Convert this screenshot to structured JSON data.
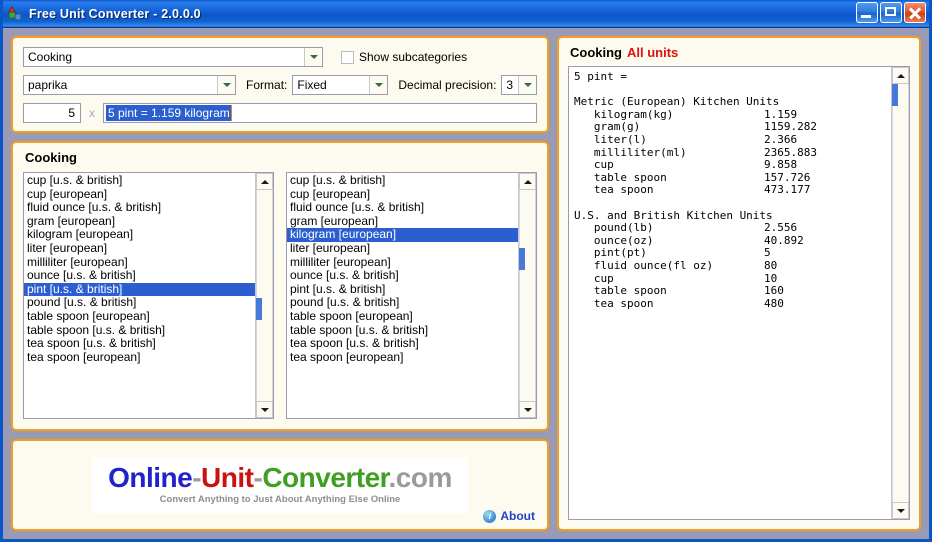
{
  "window": {
    "title": "Free Unit Converter - 2.0.0.0",
    "app_icon": "blocks-icon",
    "minimize_label": "Minimize",
    "maximize_label": "Maximize",
    "close_label": "Close"
  },
  "controls": {
    "category": {
      "value": "Cooking",
      "icon": "chevron-down-icon"
    },
    "show_subcategories": {
      "label": "Show subcategories",
      "checked": false
    },
    "subcategory": {
      "value": "paprika",
      "icon": "chevron-down-icon"
    },
    "format": {
      "label": "Format:",
      "value": "Fixed",
      "icon": "chevron-down-icon"
    },
    "precision": {
      "label": "Decimal precision:",
      "value": "3",
      "icon": "chevron-down-icon"
    },
    "amount": {
      "value": "5"
    },
    "separator": "x",
    "result": {
      "value": "5 pint = 1.159 kilogram"
    }
  },
  "lists": {
    "title": "Cooking",
    "from": {
      "selected": "pint [u.s. & british]",
      "items": [
        "cup [u.s. & british]",
        "cup [european]",
        "fluid ounce [u.s. & british]",
        "gram [european]",
        "kilogram [european]",
        "liter [european]",
        "milliliter [european]",
        "ounce [u.s. & british]",
        "pint [u.s. & british]",
        "pound [u.s. & british]",
        "table spoon [european]",
        "table spoon [u.s. & british]",
        "tea spoon [u.s. & british]",
        "tea spoon [european]"
      ]
    },
    "to": {
      "selected": "kilogram [european]",
      "items": [
        "cup [u.s. & british]",
        "cup [european]",
        "fluid ounce [u.s. & british]",
        "gram [european]",
        "kilogram [european]",
        "liter [european]",
        "milliliter [european]",
        "ounce [u.s. & british]",
        "pint [u.s. & british]",
        "pound [u.s. & british]",
        "table spoon [european]",
        "table spoon [u.s. & british]",
        "tea spoon [u.s. & british]",
        "tea spoon [european]"
      ]
    }
  },
  "branding": {
    "logo": {
      "part1": "Online",
      "dash1": "-",
      "part2": "Unit",
      "dash2": "-",
      "part3": "Converter",
      "part4": ".com",
      "color1": "#2222cc",
      "color2": "#cc1111",
      "color3": "#3f9f22",
      "color_gray": "#9a9a9a"
    },
    "tagline": "Convert Anything to Just About Anything Else Online",
    "about": {
      "label": "About",
      "icon": "info-icon"
    }
  },
  "results": {
    "category": "Cooking",
    "scope": "All units",
    "header": "5 pint =",
    "groups": [
      {
        "name": "Metric (European) Kitchen Units",
        "rows": [
          {
            "unit": "kilogram(kg)",
            "value": "1.159"
          },
          {
            "unit": "gram(g)",
            "value": "1159.282"
          },
          {
            "unit": "liter(l)",
            "value": "2.366"
          },
          {
            "unit": "milliliter(ml)",
            "value": "2365.883"
          },
          {
            "unit": "cup",
            "value": "9.858"
          },
          {
            "unit": "table spoon",
            "value": "157.726"
          },
          {
            "unit": "tea spoon",
            "value": "473.177"
          }
        ]
      },
      {
        "name": "U.S. and British Kitchen Units",
        "rows": [
          {
            "unit": "pound(lb)",
            "value": "2.556"
          },
          {
            "unit": "ounce(oz)",
            "value": "40.892"
          },
          {
            "unit": "pint(pt)",
            "value": "5"
          },
          {
            "unit": "fluid ounce(fl oz)",
            "value": "80"
          },
          {
            "unit": "cup",
            "value": "10"
          },
          {
            "unit": "table spoon",
            "value": "160"
          },
          {
            "unit": "tea spoon",
            "value": "480"
          }
        ]
      }
    ]
  },
  "theme": {
    "panel_border": "#f0a020",
    "panel_bg": "#fdfaef",
    "window_bg": "#9a9ab4",
    "selection": "#2b5fd0",
    "titlebar": "#1464dc"
  }
}
